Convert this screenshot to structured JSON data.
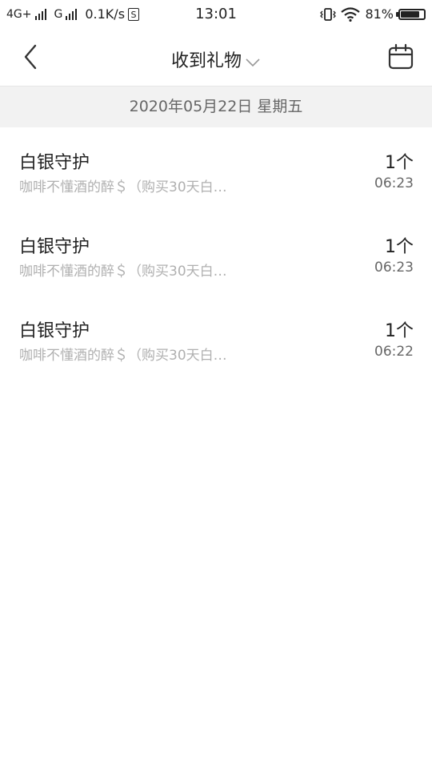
{
  "status_bar": {
    "network1": "4G+",
    "network2": "G",
    "speed": "0.1K/s",
    "sim_label": "S",
    "time": "13:01",
    "battery": "81%",
    "battery_level": 0.81
  },
  "header": {
    "title": "收到礼物"
  },
  "date_header": "2020年05月22日 星期五",
  "gifts": [
    {
      "name": "白银守护",
      "detail": "咖啡不懂酒的醉＄（购买30天白…",
      "quantity": "1个",
      "time": "06:23"
    },
    {
      "name": "白银守护",
      "detail": "咖啡不懂酒的醉＄（购买30天白…",
      "quantity": "1个",
      "time": "06:23"
    },
    {
      "name": "白银守护",
      "detail": "咖啡不懂酒的醉＄（购买30天白…",
      "quantity": "1个",
      "time": "06:22"
    }
  ],
  "colors": {
    "date_bar_bg": "#f2f2f2",
    "secondary_text": "#b0b0b0",
    "divider": "#e6e6e6"
  }
}
